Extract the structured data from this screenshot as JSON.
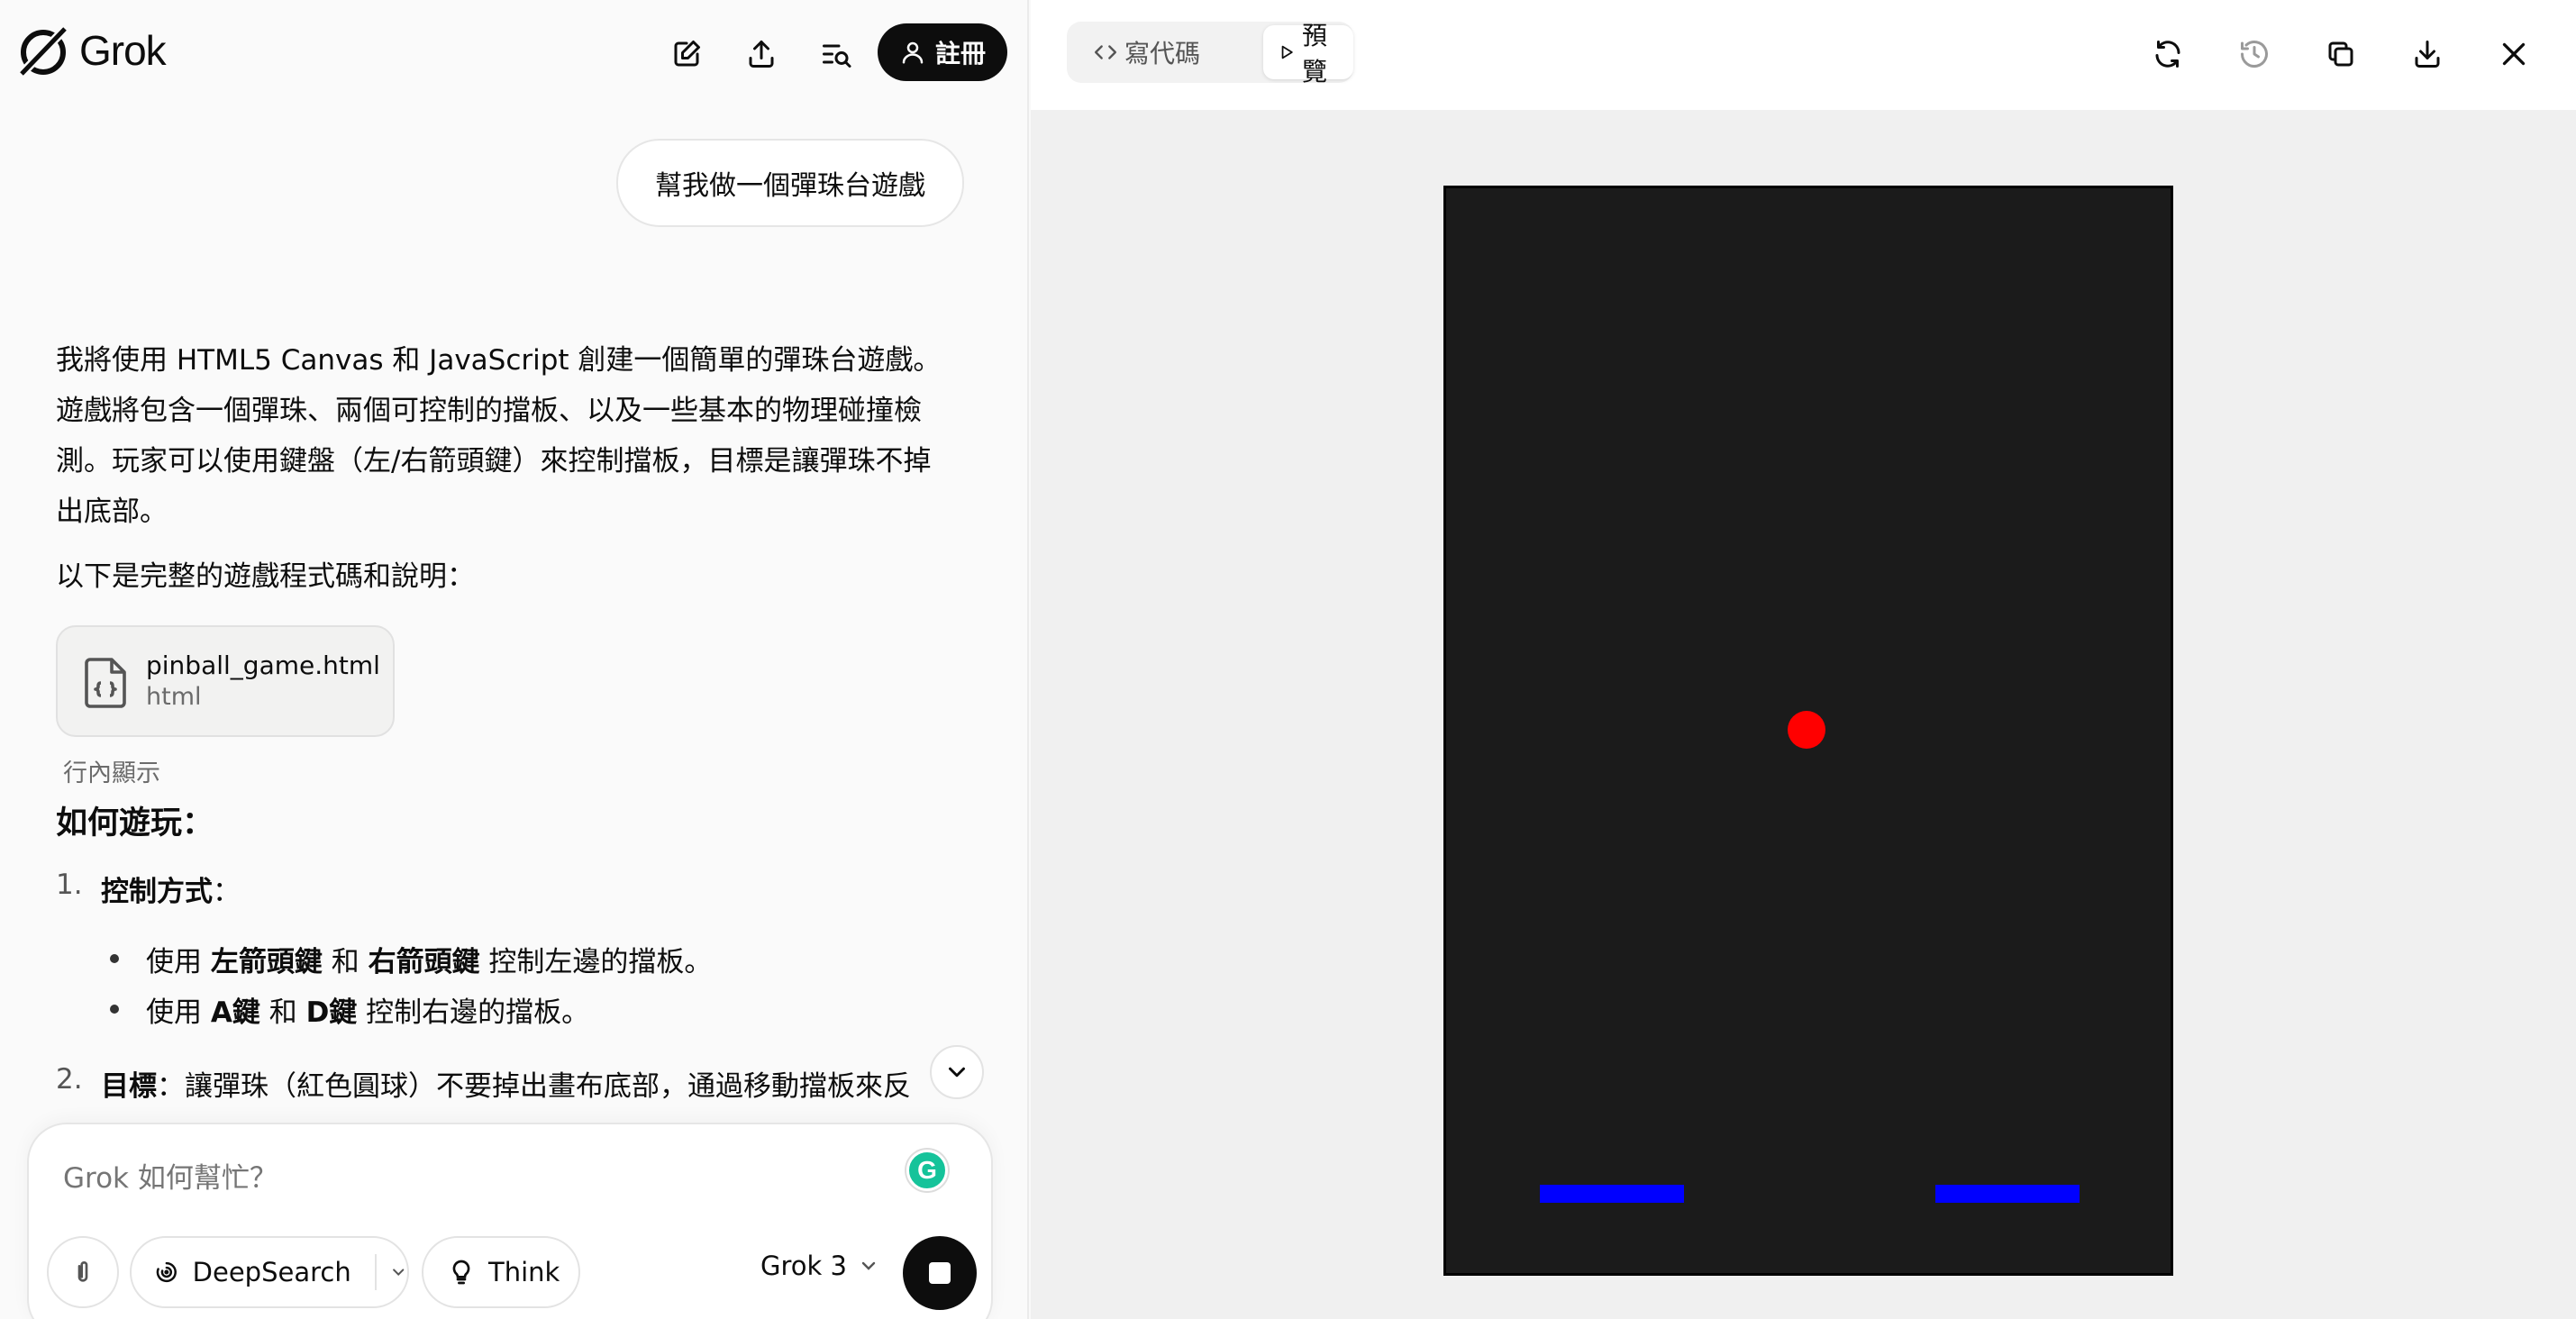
{
  "brand": {
    "name": "Grok"
  },
  "header": {
    "signup_label": "註冊"
  },
  "conversation": {
    "user_message": "幫我做一個彈珠台遊戲",
    "intro_lines": [
      "我將使用 HTML5 Canvas 和 JavaScript 創建一個簡單的彈珠台遊戲。",
      "遊戲將包含一個彈珠、兩個可控制的擋板、以及一些基本的物理碰撞檢",
      "測。玩家可以使用鍵盤（左/右箭頭鍵）來控制擋板，目標是讓彈珠不掉",
      "出底部。"
    ],
    "code_intro": "以下是完整的遊戲程式碼和說明：",
    "file": {
      "name": "pinball_game.html",
      "type": "html"
    },
    "inline_show": "行內顯示",
    "howto_title": "如何遊玩：",
    "steps": [
      {
        "num": "1.",
        "title": "控制方式",
        "rest": "：",
        "bullets": [
          {
            "pre": "使用 ",
            "b1": "左箭頭鍵",
            "mid": " 和 ",
            "b2": "右箭頭鍵",
            "post": " 控制左邊的擋板。"
          },
          {
            "pre": "使用 ",
            "b1": "A鍵",
            "mid": " 和 ",
            "b2": "D鍵",
            "post": " 控制右邊的擋板。"
          }
        ]
      },
      {
        "num": "2.",
        "title": "目標",
        "rest": "：讓彈珠（紅色圓球）不要掉出畫布底部，通過移動擋板來反"
      }
    ]
  },
  "composer": {
    "placeholder": "Grok 如何幫忙？",
    "deepsearch_label": "DeepSearch",
    "think_label": "Think",
    "model_label": "Grok 3",
    "grammar_badge": "G"
  },
  "preview_panel": {
    "tab_code": "寫代碼",
    "tab_preview": "預覽",
    "active_tab": "preview",
    "game": {
      "background": "#1b1b1b",
      "ball_color": "#ff0000",
      "paddle_color": "#0000ff"
    }
  },
  "colors": {
    "accent": "#0d0d0d",
    "grammar": "#15c39a"
  }
}
